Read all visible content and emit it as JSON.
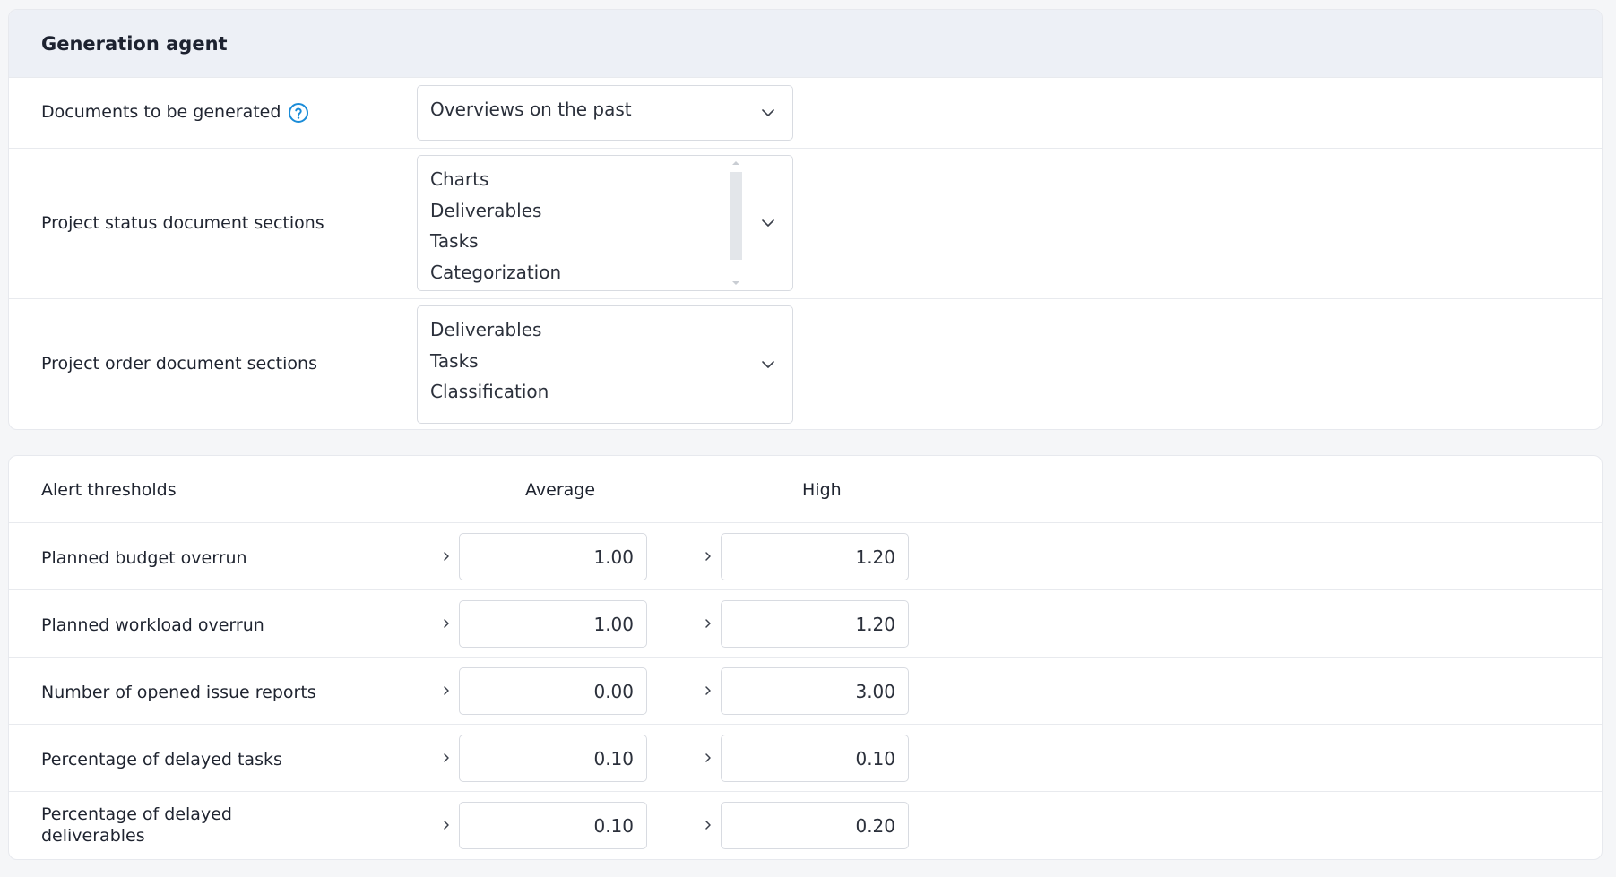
{
  "generation_agent": {
    "title": "Generation agent",
    "documents_label": "Documents to be generated",
    "documents_value": "Overviews on the past",
    "status_sections_label": "Project status document sections",
    "status_sections_options": [
      "Charts",
      "Deliverables",
      "Tasks",
      "Categorization"
    ],
    "order_sections_label": "Project order document sections",
    "order_sections_options": [
      "Deliverables",
      "Tasks",
      "Classification"
    ]
  },
  "alert_thresholds": {
    "title": "Alert thresholds",
    "col_average": "Average",
    "col_high": "High",
    "rows": [
      {
        "label": "Planned budget overrun",
        "average": "1.00",
        "high": "1.20"
      },
      {
        "label": "Planned workload overrun",
        "average": "1.00",
        "high": "1.20"
      },
      {
        "label": "Number of opened issue reports",
        "average": "0.00",
        "high": "3.00"
      },
      {
        "label": "Percentage of delayed tasks",
        "average": "0.10",
        "high": "0.10"
      },
      {
        "label": "Percentage of delayed deliverables",
        "average": "0.10",
        "high": "0.20"
      }
    ]
  },
  "colors": {
    "accent": "#1a8cd8",
    "header_bg": "#edf0f6",
    "border": "#d8dbe1"
  },
  "icons": {
    "help": "question-circle-icon",
    "dropdown": "chevron-down-icon",
    "comparator": "chevron-right-icon"
  }
}
